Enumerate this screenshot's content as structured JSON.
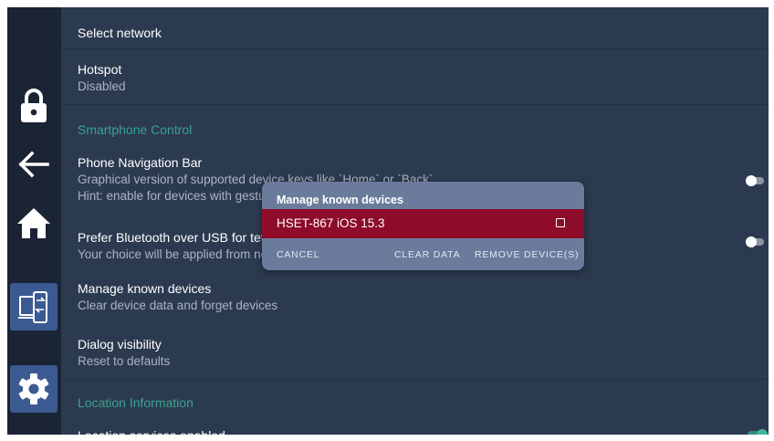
{
  "settings": {
    "select_network": "Select network",
    "hotspot": {
      "title": "Hotspot",
      "subtitle": "Disabled"
    },
    "smartphone_section": "Smartphone Control",
    "nav_bar": {
      "title": "Phone Navigation Bar",
      "subtitle1": "Graphical version of supported device keys like `Home` or `Back`",
      "subtitle2": "Hint: enable for devices with gestures",
      "toggle_on": false
    },
    "bluetooth": {
      "title": "Prefer Bluetooth over USB for tethering",
      "subtitle": "Your choice will be applied from next connection",
      "toggle_on": false
    },
    "manage_devices": {
      "title": "Manage known devices",
      "subtitle": "Clear device data and forget devices"
    },
    "dialog_visibility": {
      "title": "Dialog visibility",
      "subtitle": "Reset to defaults"
    },
    "location_section": "Location Information",
    "location_services": {
      "title": "Location services enabled",
      "toggle_on": true
    }
  },
  "sidebar": {
    "items": [
      {
        "icon": "lock-icon"
      },
      {
        "icon": "back-arrow-icon"
      },
      {
        "icon": "home-icon"
      },
      {
        "icon": "phone-mirror-icon"
      },
      {
        "icon": "gear-icon",
        "selected": true
      }
    ]
  },
  "dialog": {
    "title": "Manage known devices",
    "device": {
      "name": "HSET-867 iOS 15.3",
      "checked": false
    },
    "buttons": {
      "cancel": "CANCEL",
      "clear": "CLEAR DATA",
      "remove": "REMOVE DEVICE(S)"
    }
  },
  "colors": {
    "background": "#2c3a50",
    "sidebar": "#1b2435",
    "accent": "#3aa38e",
    "selection": "#8e0b2a",
    "dialog": "#6a7b9c"
  }
}
